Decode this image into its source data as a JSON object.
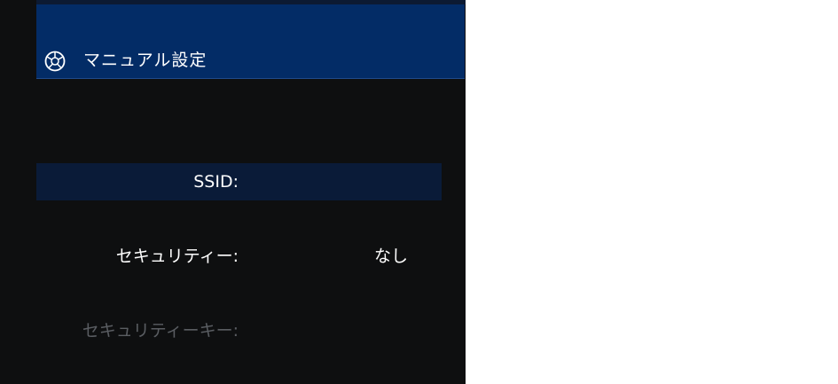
{
  "header": {
    "title": "マニュアル設定",
    "icon": "network-globe-icon"
  },
  "settings": [
    {
      "label": "SSID:",
      "value": "",
      "state": "selected"
    },
    {
      "label": "セキュリティー:",
      "value": "なし",
      "state": "normal"
    },
    {
      "label": "セキュリティーキー:",
      "value": "",
      "state": "disabled"
    }
  ],
  "colors": {
    "background": "#0e0f10",
    "header": "#032c66",
    "selected_row": "#0a1b38",
    "text": "#ffffff",
    "disabled_text": "#5a5d62"
  }
}
